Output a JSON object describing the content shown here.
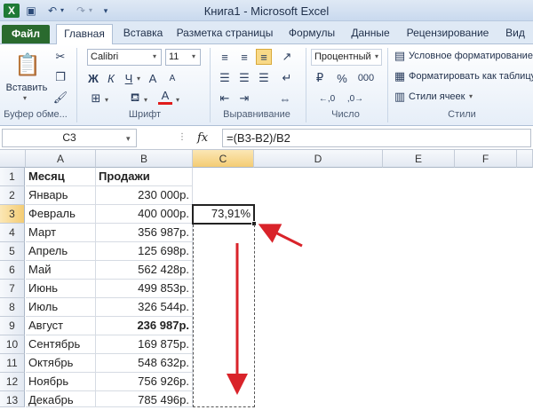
{
  "window": {
    "title": "Книга1 - Microsoft Excel"
  },
  "tabs": [
    "Файл",
    "Главная",
    "Вставка",
    "Разметка страницы",
    "Формулы",
    "Данные",
    "Рецензирование",
    "Вид"
  ],
  "ribbon": {
    "clipboard": {
      "paste_label": "Вставить",
      "group_label": "Буфер обме..."
    },
    "font": {
      "name": "Calibri",
      "size": "11",
      "group_label": "Шрифт",
      "bold": "Ж",
      "italic": "К",
      "underline": "Ч",
      "grow": "A",
      "font_color": "A",
      "font_color_hex": "#e01b1b"
    },
    "alignment": {
      "group_label": "Выравнивание"
    },
    "number": {
      "format": "Процентный",
      "percent": "%",
      "thousands": "000",
      "group_label": "Число"
    },
    "styles": {
      "conditional": "Условное форматирование",
      "as_table": "Форматировать как таблицу",
      "cell_styles": "Стили ячеек",
      "group_label": "Стили"
    }
  },
  "formula_bar": {
    "name_box": "C3",
    "fx": "fx",
    "formula": "=(B3-B2)/B2"
  },
  "sheet": {
    "columns": [
      "A",
      "B",
      "C",
      "D",
      "E",
      "F"
    ],
    "rows": [
      "1",
      "2",
      "3",
      "4",
      "5",
      "6",
      "7",
      "8",
      "9",
      "10",
      "11",
      "12",
      "13"
    ],
    "header": {
      "a": "Месяц",
      "b": "Продажи"
    },
    "data": [
      {
        "month": "Январь",
        "sales": "230 000р."
      },
      {
        "month": "Февраль",
        "sales": "400 000р.",
        "c": "73,91%"
      },
      {
        "month": "Март",
        "sales": "356 987р."
      },
      {
        "month": "Апрель",
        "sales": "125 698р."
      },
      {
        "month": "Май",
        "sales": "562 428р."
      },
      {
        "month": "Июнь",
        "sales": "499 853р."
      },
      {
        "month": "Июль",
        "sales": "326 544р."
      },
      {
        "month": "Август",
        "sales": "236 987р."
      },
      {
        "month": "Сентябрь",
        "sales": "169 875р."
      },
      {
        "month": "Октябрь",
        "sales": "548 632р."
      },
      {
        "month": "Ноябрь",
        "sales": "756 926р."
      },
      {
        "month": "Декабрь",
        "sales": "785 496р."
      }
    ],
    "active_cell": "C3",
    "annotation_color": "#d9232a"
  }
}
